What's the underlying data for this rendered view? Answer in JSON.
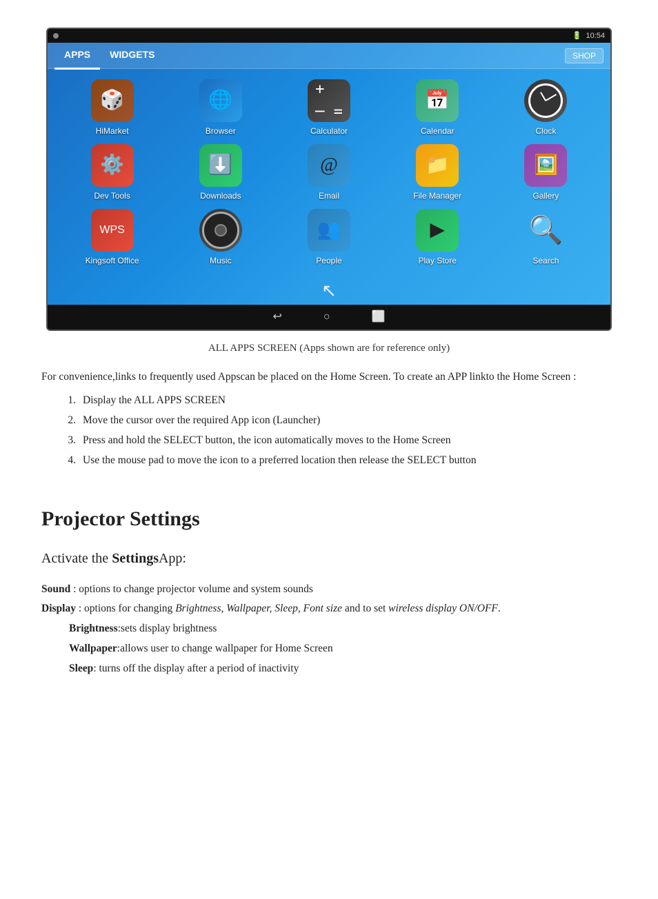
{
  "device": {
    "statusBar": {
      "time": "10:54",
      "leftIcon": "android-icon"
    },
    "tabs": [
      {
        "label": "APPS",
        "active": true
      },
      {
        "label": "WIDGETS",
        "active": false
      }
    ],
    "shopLabel": "SHOP",
    "apps": [
      {
        "id": "himarket",
        "label": "HiMarket",
        "icon": "🎲",
        "iconClass": "icon-himarket"
      },
      {
        "id": "browser",
        "label": "Browser",
        "icon": "🌐",
        "iconClass": "icon-browser"
      },
      {
        "id": "calculator",
        "label": "Calculator",
        "icon": "🧮",
        "iconClass": "icon-calculator"
      },
      {
        "id": "calendar",
        "label": "Calendar",
        "icon": "📅",
        "iconClass": "icon-calendar"
      },
      {
        "id": "clock",
        "label": "Clock",
        "icon": "clock",
        "iconClass": "icon-clock"
      },
      {
        "id": "devtools",
        "label": "Dev Tools",
        "icon": "⚙️",
        "iconClass": "icon-devtools"
      },
      {
        "id": "downloads",
        "label": "Downloads",
        "icon": "⬇️",
        "iconClass": "icon-downloads"
      },
      {
        "id": "email",
        "label": "Email",
        "icon": "✉️",
        "iconClass": "icon-email"
      },
      {
        "id": "filemanager",
        "label": "File Manager",
        "icon": "📁",
        "iconClass": "icon-filemanager"
      },
      {
        "id": "gallery",
        "label": "Gallery",
        "icon": "🖼️",
        "iconClass": "icon-gallery"
      },
      {
        "id": "kingsoft",
        "label": "Kingsoft Office",
        "icon": "📝",
        "iconClass": "icon-kingsoft"
      },
      {
        "id": "music",
        "label": "Music",
        "icon": "music",
        "iconClass": "icon-music"
      },
      {
        "id": "people",
        "label": "People",
        "icon": "👥",
        "iconClass": "icon-people"
      },
      {
        "id": "playstore",
        "label": "Play Store",
        "icon": "▶️",
        "iconClass": "icon-playstore"
      },
      {
        "id": "search",
        "label": "Search",
        "icon": "🔍",
        "iconClass": "icon-search"
      }
    ],
    "navButtons": [
      "↩",
      "○",
      "⬜"
    ]
  },
  "caption": "ALL APPS SCREEN (Apps shown are for reference only)",
  "bodyText": "For convenience,links to frequently used Appscan be placed on the Home Screen. To create an APP linkto the Home Screen :",
  "steps": [
    "Display the ALL APPS SCREEN",
    "Move the cursor over the required App icon (Launcher)",
    "Press and hold the SELECT button, the icon automatically moves to the Home Screen",
    "Use the mouse pad to move the icon to a preferred location then release the SELECT button"
  ],
  "sectionTitle": "Projector Settings",
  "subsectionTitle": {
    "prefix": "Activate the ",
    "bold": "Settings",
    "suffix": "App:"
  },
  "settings": [
    {
      "term": "Sound",
      "desc": " : options to change projector volume and system sounds"
    },
    {
      "term": "Display",
      "desc": " : options for changing ",
      "italicParts": "Brightness, Wallpaper, Sleep, Font size",
      "descSuffix": " and to set ",
      "italicSuffix": "wireless display ON/OFF",
      "dotSuffix": "."
    }
  ],
  "subSettings": [
    {
      "term": "Brightness",
      "desc": ":sets display brightness"
    },
    {
      "term": "Wallpaper",
      "desc": ":allows user to change wallpaper for Home Screen"
    },
    {
      "term": "Sleep",
      "desc": ": turns off the display after a period of inactivity"
    }
  ]
}
